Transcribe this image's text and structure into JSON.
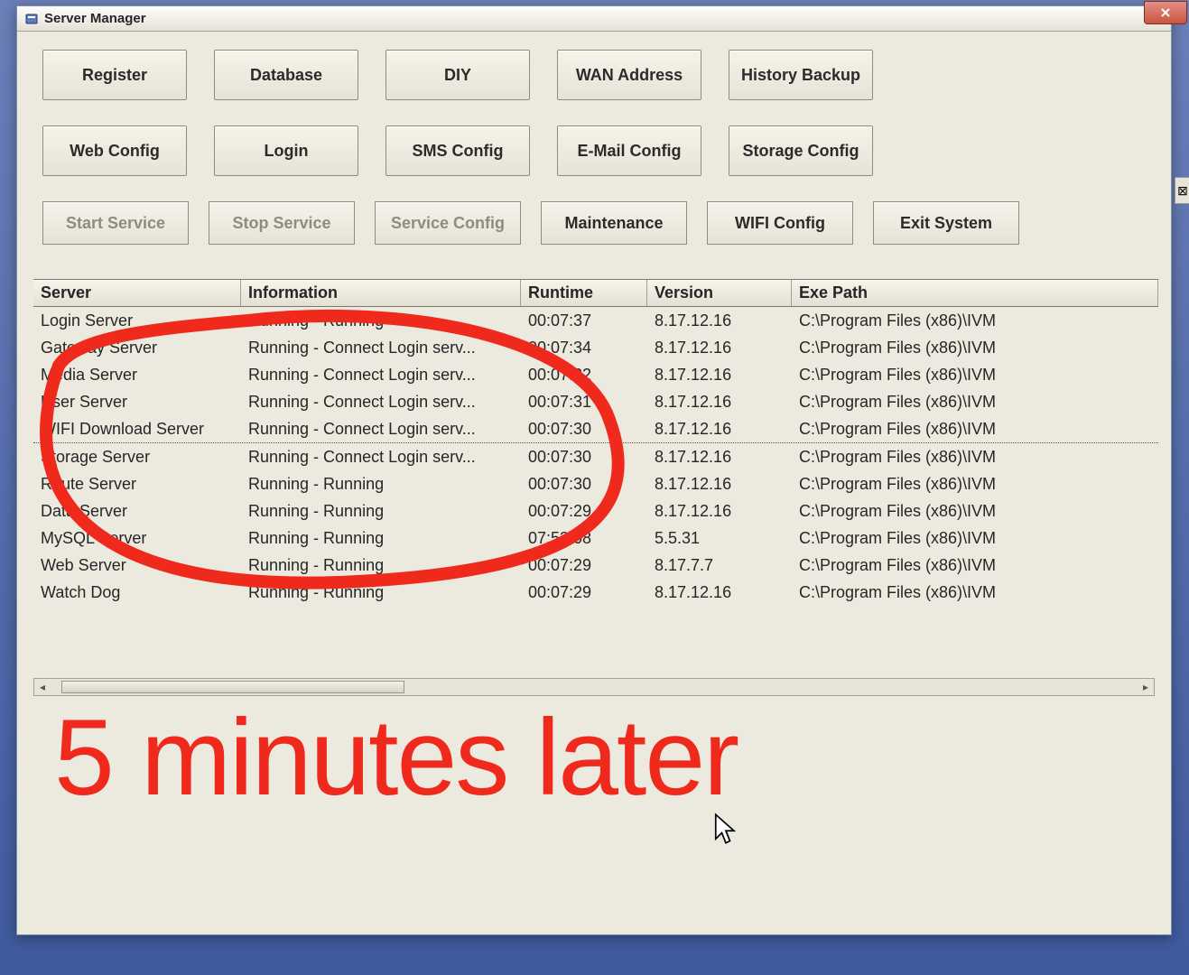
{
  "window": {
    "title": "Server Manager",
    "close_tooltip": "Close"
  },
  "toolbar": {
    "row1": [
      {
        "id": "register",
        "label": "Register"
      },
      {
        "id": "database",
        "label": "Database"
      },
      {
        "id": "diy",
        "label": "DIY"
      },
      {
        "id": "wan-address",
        "label": "WAN Address"
      },
      {
        "id": "history-backup",
        "label": "History Backup"
      }
    ],
    "row2": [
      {
        "id": "web-config",
        "label": "Web Config"
      },
      {
        "id": "login",
        "label": "Login"
      },
      {
        "id": "sms-config",
        "label": "SMS Config"
      },
      {
        "id": "email-config",
        "label": "E-Mail Config"
      },
      {
        "id": "storage-config",
        "label": "Storage Config"
      }
    ],
    "service_row": [
      {
        "id": "start-service",
        "label": "Start Service",
        "enabled": false
      },
      {
        "id": "stop-service",
        "label": "Stop Service",
        "enabled": false
      },
      {
        "id": "service-config",
        "label": "Service Config",
        "enabled": false
      },
      {
        "id": "maintenance",
        "label": "Maintenance",
        "enabled": true
      },
      {
        "id": "wifi-config",
        "label": "WIFI Config",
        "enabled": true
      },
      {
        "id": "exit-system",
        "label": "Exit System",
        "enabled": true
      }
    ]
  },
  "grid": {
    "columns": {
      "server": "Server",
      "information": "Information",
      "runtime": "Runtime",
      "version": "Version",
      "exe_path": "Exe Path"
    },
    "rows": [
      {
        "server": "Login Server",
        "information": "Running - Running",
        "runtime": "00:07:37",
        "version": "8.17.12.16",
        "exe_path": "C:\\Program Files (x86)\\IVM"
      },
      {
        "server": "Gateway Server",
        "information": "Running - Connect Login serv...",
        "runtime": "00:07:34",
        "version": "8.17.12.16",
        "exe_path": "C:\\Program Files (x86)\\IVM"
      },
      {
        "server": "Media Server",
        "information": "Running - Connect Login serv...",
        "runtime": "00:07:32",
        "version": "8.17.12.16",
        "exe_path": "C:\\Program Files (x86)\\IVM"
      },
      {
        "server": "User Server",
        "information": "Running - Connect Login serv...",
        "runtime": "00:07:31",
        "version": "8.17.12.16",
        "exe_path": "C:\\Program Files (x86)\\IVM"
      },
      {
        "server": "WIFI Download Server",
        "information": "Running - Connect Login serv...",
        "runtime": "00:07:30",
        "version": "8.17.12.16",
        "exe_path": "C:\\Program Files (x86)\\IVM"
      },
      {
        "server": "Storage Server",
        "information": "Running - Connect Login serv...",
        "runtime": "00:07:30",
        "version": "8.17.12.16",
        "exe_path": "C:\\Program Files (x86)\\IVM"
      },
      {
        "server": "Route Server",
        "information": "Running - Running",
        "runtime": "00:07:30",
        "version": "8.17.12.16",
        "exe_path": "C:\\Program Files (x86)\\IVM"
      },
      {
        "server": "Data Server",
        "information": "Running - Running",
        "runtime": "00:07:29",
        "version": "8.17.12.16",
        "exe_path": "C:\\Program Files (x86)\\IVM"
      },
      {
        "server": "MySQL Server",
        "information": "Running - Running",
        "runtime": "07:53:08",
        "version": "5.5.31",
        "exe_path": "C:\\Program Files (x86)\\IVM"
      },
      {
        "server": "Web Server",
        "information": "Running - Running",
        "runtime": "00:07:29",
        "version": "8.17.7.7",
        "exe_path": "C:\\Program Files (x86)\\IVM"
      },
      {
        "server": "Watch Dog",
        "information": "Running - Running",
        "runtime": "00:07:29",
        "version": "8.17.12.16",
        "exe_path": "C:\\Program Files (x86)\\IVM"
      }
    ],
    "dotted_after_index": 4
  },
  "annotation": {
    "text": "5 minutes later",
    "color": "#ef2a1c"
  }
}
